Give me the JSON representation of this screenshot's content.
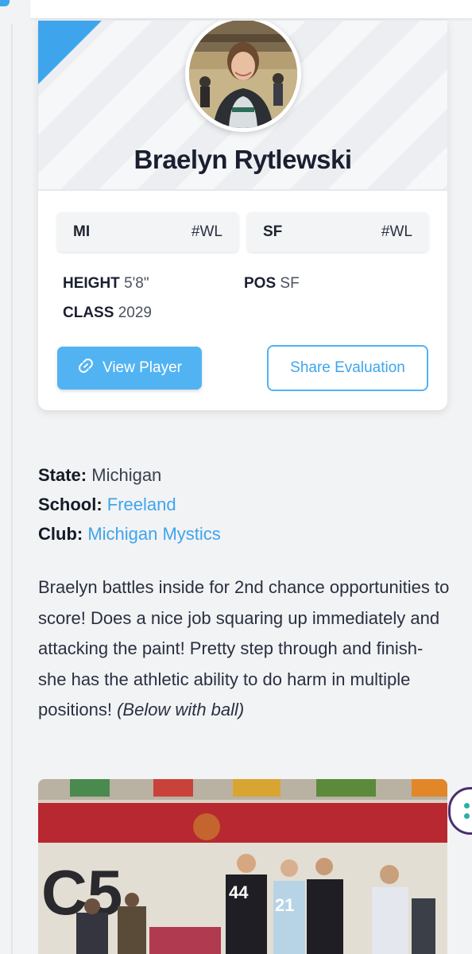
{
  "player": {
    "name": "Braelyn Rytlewski",
    "state_tag": "MI",
    "state_rank": "#WL",
    "pos_tag": "SF",
    "pos_rank": "#WL",
    "height_label": "HEIGHT",
    "height_value": "5'8\"",
    "pos_label": "POS",
    "pos_value": "SF",
    "class_label": "CLASS",
    "class_value": "2029"
  },
  "buttons": {
    "view_player": "View Player",
    "share_evaluation": "Share Evaluation"
  },
  "info": {
    "state_label": "State:",
    "state_value": "Michigan",
    "school_label": "School:",
    "school_value": "Freeland",
    "club_label": "Club:",
    "club_value": "Michigan Mystics"
  },
  "evaluation": {
    "text": "Braelyn battles inside for 2nd chance opportunities to score! Does a nice job squaring up immediately and attacking the paint! Pretty step through and finish- she has the athletic ability to do harm in multiple positions!",
    "note": "(Below with ball)"
  },
  "colors": {
    "accent": "#3ea5ec",
    "button": "#52b3f3",
    "background": "#f2f3f5"
  },
  "icons": {
    "link": "link-icon",
    "floating": "grid-dots-icon"
  }
}
